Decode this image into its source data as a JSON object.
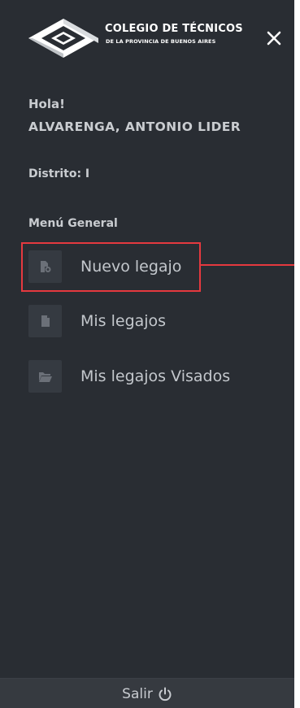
{
  "header": {
    "brand_line1": "COLEGIO DE TÉCNICOS",
    "brand_line2": "DE LA PROVINCIA DE BUENOS AIRES",
    "close_icon": "close-icon"
  },
  "user": {
    "greeting": "Hola!",
    "name": "ALVARENGA, ANTONIO LIDER",
    "district": "Distrito: I"
  },
  "menu": {
    "title": "Menú General",
    "items": [
      {
        "label": "Nuevo legajo",
        "icon": "file-add-icon",
        "highlighted": true
      },
      {
        "label": "Mis legajos",
        "icon": "file-icon",
        "highlighted": false
      },
      {
        "label": "Mis legajos Visados",
        "icon": "folder-open-icon",
        "highlighted": false
      }
    ]
  },
  "footer": {
    "logout_label": "Salir",
    "logout_icon": "power-icon"
  },
  "colors": {
    "sidebar_bg": "#292d33",
    "highlight": "#e5393f",
    "text": "#c9ccd0"
  }
}
